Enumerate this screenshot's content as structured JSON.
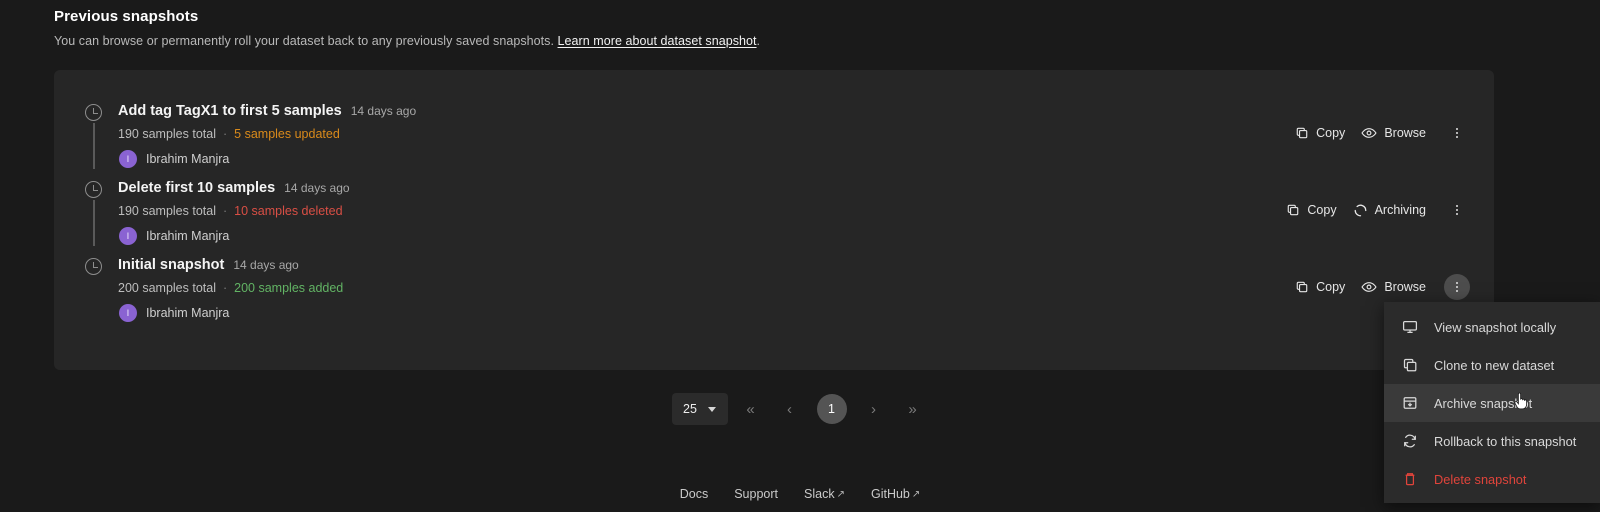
{
  "header": {
    "title": "Previous snapshots",
    "subtitle_before": "You can browse or permanently roll your dataset back to any previously saved snapshots.",
    "link_text": "Learn more about dataset snapshot",
    "subtitle_after": "."
  },
  "snapshots": [
    {
      "name": "Add tag TagX1 to first 5 samples",
      "age": "14 days ago",
      "total": "190 samples total",
      "separator": "·",
      "change": "5 samples updated",
      "change_kind": "updated",
      "user": "Ibrahim Manjra",
      "avatar_initial": "I",
      "copy_label": "Copy",
      "status_label": "Browse",
      "status_kind": "browse"
    },
    {
      "name": "Delete first 10 samples",
      "age": "14 days ago",
      "total": "190 samples total",
      "separator": "·",
      "change": "10 samples deleted",
      "change_kind": "deleted",
      "user": "Ibrahim Manjra",
      "avatar_initial": "I",
      "copy_label": "Copy",
      "status_label": "Archiving",
      "status_kind": "archiving"
    },
    {
      "name": "Initial snapshot",
      "age": "14 days ago",
      "total": "200 samples total",
      "separator": "·",
      "change": "200 samples added",
      "change_kind": "added",
      "user": "Ibrahim Manjra",
      "avatar_initial": "I",
      "copy_label": "Copy",
      "status_label": "Browse",
      "status_kind": "browse"
    }
  ],
  "menu": {
    "items": [
      {
        "label": "View snapshot locally",
        "icon": "monitor-icon",
        "hovered": false,
        "danger": false
      },
      {
        "label": "Clone to new dataset",
        "icon": "copy-icon",
        "hovered": false,
        "danger": false
      },
      {
        "label": "Archive snapshot",
        "icon": "archive-icon",
        "hovered": true,
        "danger": false
      },
      {
        "label": "Rollback to this snapshot",
        "icon": "refresh-icon",
        "hovered": false,
        "danger": false
      },
      {
        "label": "Delete snapshot",
        "icon": "trash-icon",
        "hovered": false,
        "danger": true
      }
    ]
  },
  "pagination": {
    "page_size": "25",
    "first_label": "«",
    "prev_label": "‹",
    "current_page": "1",
    "next_label": "›",
    "last_label": "»"
  },
  "footer": {
    "links": [
      {
        "label": "Docs",
        "external": false
      },
      {
        "label": "Support",
        "external": false
      },
      {
        "label": "Slack",
        "external": true
      },
      {
        "label": "GitHub",
        "external": true
      }
    ],
    "external_glyph": "↗"
  },
  "colors": {
    "background": "#1a1a1a",
    "card": "#262626",
    "menu": "#2b2b2b",
    "accent_updated": "#d98a1b",
    "accent_deleted": "#d94f45",
    "accent_added": "#62b364",
    "danger": "#e0443b",
    "avatar": "#8a63d2"
  }
}
